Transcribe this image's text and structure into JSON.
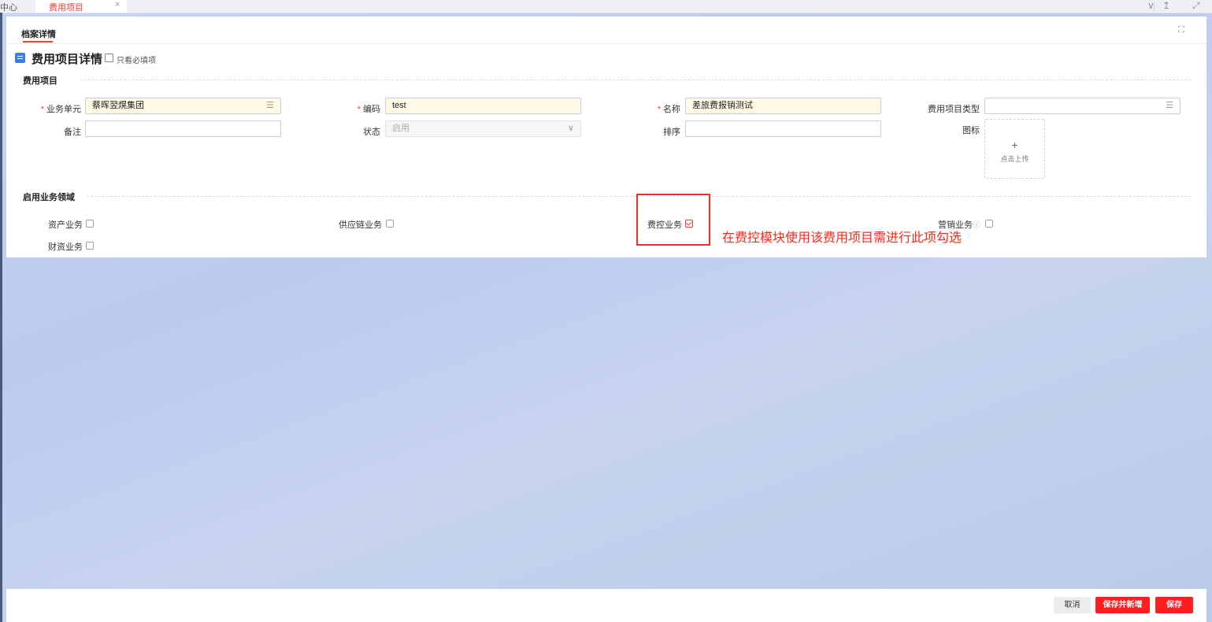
{
  "tabs": {
    "prev_label": "中心",
    "active_label": "费用项目",
    "close_symbol": "×"
  },
  "toolbar_icons": [
    "chevron-down-icon",
    "upload-icon",
    "expand-icon"
  ],
  "subtab": "档案详情",
  "page": {
    "title": "费用项目详情",
    "required_only_label": "只看必填项"
  },
  "section_basic": {
    "title": "费用项目",
    "fields": {
      "business_unit": {
        "label": "业务单元",
        "value": "蔡晖翌熀集团",
        "required": true
      },
      "code": {
        "label": "编码",
        "value": "test",
        "required": true
      },
      "name": {
        "label": "名称",
        "value": "差旅费报销测试",
        "required": true
      },
      "item_type": {
        "label": "费用项目类型",
        "value": "",
        "required": false
      },
      "remark": {
        "label": "备注",
        "value": ""
      },
      "status": {
        "label": "状态",
        "value": "启用"
      },
      "sort": {
        "label": "排序",
        "value": ""
      },
      "icon": {
        "label": "图标",
        "upload_plus": "+",
        "upload_text": "点击上传"
      }
    }
  },
  "section_domain": {
    "title": "启用业务领域",
    "items": {
      "asset": {
        "label": "资产业务",
        "checked": false
      },
      "supply": {
        "label": "供应链业务",
        "checked": false
      },
      "expense": {
        "label": "费控业务",
        "checked": true
      },
      "marketing": {
        "label": "营销业务",
        "checked": false
      },
      "finance": {
        "label": "财资业务",
        "checked": false
      }
    }
  },
  "annotation": "在费控模块使用该费用项目需进行此项勾选",
  "footer": {
    "cancel": "取消",
    "save_new": "保存并新增",
    "save": "保存"
  },
  "colors": {
    "accent": "#ff3b30",
    "annotation": "#ff2a1a",
    "required_fill": "#fff9e6",
    "doc_icon": "#3d7cf3"
  }
}
